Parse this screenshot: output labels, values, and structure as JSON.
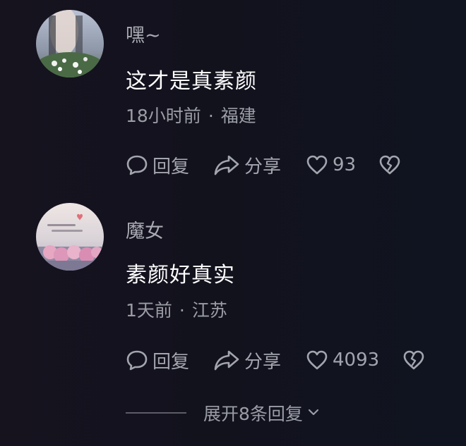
{
  "comments": [
    {
      "username": "嘿~",
      "text": "这才是真素颜",
      "time": "18小时前",
      "location": "福建",
      "reply_label": "回复",
      "share_label": "分享",
      "like_count": "93",
      "reply_icon": "speech-bubble-icon",
      "share_icon": "share-arrow-icon",
      "like_icon": "heart-icon",
      "dislike_icon": "broken-heart-icon"
    },
    {
      "username": "魔女",
      "text": "素颜好真实",
      "time": "1天前",
      "location": "江苏",
      "reply_label": "回复",
      "share_label": "分享",
      "like_count": "4093",
      "reply_icon": "speech-bubble-icon",
      "share_icon": "share-arrow-icon",
      "like_icon": "heart-icon",
      "dislike_icon": "broken-heart-icon"
    }
  ],
  "expand_replies": "展开8条回复",
  "colors": {
    "background": "#12121d",
    "text_primary": "#ffffff",
    "text_secondary": "#9b9da6"
  }
}
